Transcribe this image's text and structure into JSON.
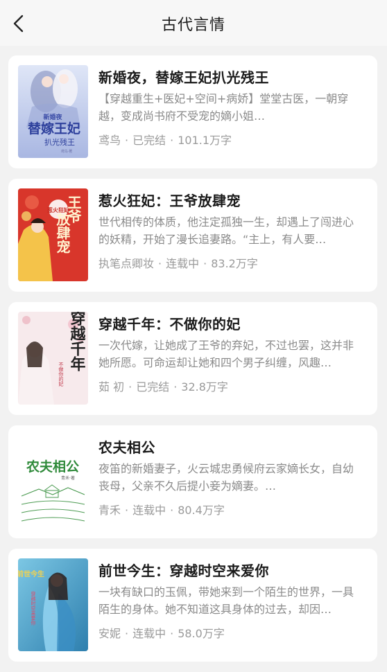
{
  "header": {
    "title": "古代言情",
    "back_icon": "chevron-left-icon"
  },
  "books": [
    {
      "title": "新婚夜，替嫁王妃扒光残王",
      "desc": "【穿越重生+医妃+空间+病娇】堂堂古医，一朝穿越，变成尚书府不受宠的嫡小姐…",
      "author": "鸢鸟",
      "status": "已完结",
      "words": "101.1万字",
      "cover": {
        "lines": [
          "新婚夜",
          "替嫁王妃",
          "扒光残王"
        ],
        "author_tag": "鸢鸟·著",
        "bg": "#c9d3ee"
      }
    },
    {
      "title": "惹火狂妃：王爷放肆宠",
      "desc": "世代相传的体质，他注定孤独一生，却遇上了闯进心的妖精，开始了漫长追妻路。“主上，有人要…",
      "author": "执笔点卿妆",
      "status": "连载中",
      "words": "83.2万字",
      "cover": {
        "lines": [
          "王爷",
          "放肆宠"
        ],
        "sub": "惹火狂妃",
        "bg": "#d93a2e"
      }
    },
    {
      "title": "穿越千年：不做你的妃",
      "desc": "一次代嫁，让她成了王爷的弃妃，不过也罢，这并非她所愿。可命运却让她和四个男子纠缠，风趣…",
      "author": "茹 初",
      "status": "已完结",
      "words": "32.8万字",
      "cover": {
        "lines": [
          "穿越千年"
        ],
        "sub": "不做你的妃",
        "bg": "#f6e8ea"
      }
    },
    {
      "title": "农夫相公",
      "desc": "夜笛的新婚妻子，火云城忠勇候府云家嫡长女，自幼丧母，父亲不久后提小妾为嫡妻。…",
      "author": "青禾",
      "status": "连载中",
      "words": "80.4万字",
      "cover": {
        "lines": [
          "农夫相公"
        ],
        "sub": "青禾·著",
        "bg": "#ffffff"
      }
    },
    {
      "title": "前世今生：穿越时空来爱你",
      "desc": "一块有缺口的玉佩，带她来到一个陌生的世界，一具陌生的身体。她不知道这具身体的过去，却因…",
      "author": "安妮",
      "status": "连载中",
      "words": "58.0万字",
      "cover": {
        "lines": [
          "前世今生"
        ],
        "sub": "穿越时空来爱你",
        "bg": "#5aa7c9"
      }
    }
  ]
}
